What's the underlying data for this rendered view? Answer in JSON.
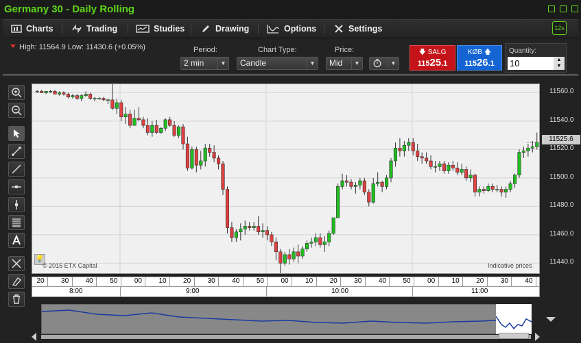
{
  "window": {
    "title": "Germany 30 - Daily Rolling"
  },
  "toolbar": {
    "charts": "Charts",
    "trading": "Trading",
    "studies": "Studies",
    "drawing": "Drawing",
    "options": "Options",
    "settings": "Settings",
    "refresh": "12s"
  },
  "header": {
    "highlow": "High: 11564.9 Low: 11430.6 (+0.05%)",
    "period_label": "Period:",
    "period_value": "2 min",
    "charttype_label": "Chart Type:",
    "charttype_value": "Candle",
    "price_label": "Price:",
    "price_value": "Mid"
  },
  "trade": {
    "sell_label": "SALG",
    "sell_small": "115",
    "sell_big": "25",
    "sell_dec": ".1",
    "buy_label": "KØB",
    "buy_small": "115",
    "buy_big": "26",
    "buy_dec": ".1",
    "quantity_label": "Quantity:",
    "quantity_value": "10"
  },
  "chart": {
    "copyright": "© 2015 ETX Capital",
    "indicative": "Indicative prices",
    "last_price": "11525.6",
    "y_ticks": [
      "11560.0",
      "11540.0",
      "11520.0",
      "11500.0",
      "11480.0",
      "11460.0",
      "11440.0"
    ],
    "minute_ticks": [
      "20",
      "30",
      "40",
      "50",
      "00",
      "10",
      "20",
      "30",
      "40",
      "50",
      "00",
      "10",
      "20",
      "30",
      "40",
      "50",
      "00",
      "10",
      "20",
      "30",
      "40"
    ],
    "hour_ticks": [
      "8:00",
      "9:00",
      "10:00",
      "11:00"
    ]
  },
  "colors": {
    "up": "#1fbf1f",
    "down": "#e04040",
    "accent": "#5fd31a"
  },
  "chart_data": {
    "type": "candlestick",
    "ylim": [
      11432,
      11566
    ],
    "candles": [
      [
        11561,
        11562,
        11560,
        11561
      ],
      [
        11561,
        11562,
        11560,
        11560
      ],
      [
        11560,
        11561,
        11559,
        11561
      ],
      [
        11561,
        11562,
        11560,
        11561
      ],
      [
        11561,
        11562,
        11559,
        11559
      ],
      [
        11559,
        11561,
        11558,
        11560
      ],
      [
        11560,
        11561,
        11558,
        11559
      ],
      [
        11559,
        11560,
        11556,
        11557
      ],
      [
        11557,
        11559,
        11556,
        11558
      ],
      [
        11558,
        11559,
        11555,
        11556
      ],
      [
        11556,
        11559,
        11554,
        11558
      ],
      [
        11558,
        11561,
        11557,
        11559
      ],
      [
        11559,
        11560,
        11555,
        11556
      ],
      [
        11556,
        11557,
        11554,
        11556
      ],
      [
        11556,
        11557,
        11555,
        11556
      ],
      [
        11556,
        11557,
        11554,
        11555
      ],
      [
        11555,
        11556,
        11552,
        11555
      ],
      [
        11555,
        11566,
        11548,
        11549
      ],
      [
        11549,
        11556,
        11545,
        11553
      ],
      [
        11553,
        11555,
        11540,
        11543
      ],
      [
        11543,
        11550,
        11538,
        11545
      ],
      [
        11545,
        11548,
        11535,
        11537
      ],
      [
        11537,
        11548,
        11537,
        11542
      ],
      [
        11542,
        11550,
        11540,
        11541
      ],
      [
        11541,
        11543,
        11535,
        11537
      ],
      [
        11537,
        11542,
        11530,
        11532
      ],
      [
        11532,
        11540,
        11529,
        11537
      ],
      [
        11537,
        11541,
        11531,
        11532
      ],
      [
        11532,
        11536,
        11531,
        11535
      ],
      [
        11535,
        11542,
        11533,
        11541
      ],
      [
        11541,
        11543,
        11536,
        11537
      ],
      [
        11537,
        11540,
        11529,
        11530
      ],
      [
        11530,
        11537,
        11528,
        11536
      ],
      [
        11536,
        11538,
        11520,
        11524
      ],
      [
        11524,
        11529,
        11505,
        11507
      ],
      [
        11507,
        11522,
        11506,
        11520
      ],
      [
        11520,
        11522,
        11504,
        11509
      ],
      [
        11509,
        11519,
        11506,
        11512
      ],
      [
        11512,
        11524,
        11508,
        11521
      ],
      [
        11521,
        11524,
        11515,
        11518
      ],
      [
        11518,
        11523,
        11511,
        11514
      ],
      [
        11514,
        11516,
        11506,
        11510
      ],
      [
        11510,
        11512,
        11488,
        11492
      ],
      [
        11492,
        11494,
        11461,
        11465
      ],
      [
        11465,
        11469,
        11455,
        11458
      ],
      [
        11458,
        11464,
        11455,
        11462
      ],
      [
        11462,
        11468,
        11456,
        11464
      ],
      [
        11464,
        11470,
        11460,
        11466
      ],
      [
        11466,
        11469,
        11463,
        11465
      ],
      [
        11465,
        11469,
        11463,
        11466
      ],
      [
        11466,
        11473,
        11460,
        11462
      ],
      [
        11462,
        11468,
        11458,
        11463
      ],
      [
        11463,
        11466,
        11456,
        11460
      ],
      [
        11460,
        11462,
        11452,
        11455
      ],
      [
        11455,
        11458,
        11442,
        11448
      ],
      [
        11448,
        11450,
        11432,
        11440
      ],
      [
        11440,
        11448,
        11438,
        11446
      ],
      [
        11446,
        11450,
        11439,
        11443
      ],
      [
        11443,
        11451,
        11441,
        11448
      ],
      [
        11448,
        11453,
        11440,
        11445
      ],
      [
        11445,
        11452,
        11443,
        11450
      ],
      [
        11450,
        11456,
        11448,
        11454
      ],
      [
        11454,
        11458,
        11451,
        11455
      ],
      [
        11455,
        11461,
        11452,
        11458
      ],
      [
        11458,
        11461,
        11451,
        11453
      ],
      [
        11453,
        11459,
        11448,
        11455
      ],
      [
        11455,
        11463,
        11452,
        11461
      ],
      [
        11461,
        11472,
        11460,
        11472
      ],
      [
        11472,
        11496,
        11472,
        11494
      ],
      [
        11494,
        11503,
        11492,
        11498
      ],
      [
        11498,
        11502,
        11494,
        11497
      ],
      [
        11497,
        11499,
        11492,
        11494
      ],
      [
        11494,
        11497,
        11489,
        11495
      ],
      [
        11495,
        11500,
        11492,
        11498
      ],
      [
        11498,
        11500,
        11488,
        11490
      ],
      [
        11490,
        11492,
        11480,
        11483
      ],
      [
        11483,
        11500,
        11482,
        11496
      ],
      [
        11496,
        11504,
        11494,
        11497
      ],
      [
        11497,
        11498,
        11490,
        11494
      ],
      [
        11494,
        11502,
        11492,
        11500
      ],
      [
        11500,
        11514,
        11497,
        11512
      ],
      [
        11512,
        11525,
        11508,
        11521
      ],
      [
        11521,
        11528,
        11515,
        11519
      ],
      [
        11519,
        11526,
        11515,
        11523
      ],
      [
        11523,
        11528,
        11519,
        11525
      ],
      [
        11525,
        11528,
        11516,
        11519
      ],
      [
        11519,
        11524,
        11512,
        11515
      ],
      [
        11515,
        11518,
        11510,
        11514
      ],
      [
        11514,
        11518,
        11510,
        11512
      ],
      [
        11512,
        11516,
        11506,
        11508
      ],
      [
        11508,
        11512,
        11504,
        11508
      ],
      [
        11508,
        11512,
        11505,
        11510
      ],
      [
        11510,
        11512,
        11503,
        11505
      ],
      [
        11505,
        11511,
        11503,
        11509
      ],
      [
        11509,
        11512,
        11505,
        11507
      ],
      [
        11507,
        11511,
        11502,
        11504
      ],
      [
        11504,
        11510,
        11502,
        11506
      ],
      [
        11506,
        11508,
        11498,
        11500
      ],
      [
        11500,
        11506,
        11497,
        11502
      ],
      [
        11502,
        11503,
        11487,
        11490
      ],
      [
        11490,
        11494,
        11487,
        11492
      ],
      [
        11492,
        11494,
        11489,
        11491
      ],
      [
        11491,
        11496,
        11490,
        11494
      ],
      [
        11494,
        11496,
        11490,
        11492
      ],
      [
        11492,
        11495,
        11490,
        11492
      ],
      [
        11492,
        11494,
        11487,
        11490
      ],
      [
        11490,
        11494,
        11486,
        11492
      ],
      [
        11492,
        11498,
        11490,
        11496
      ],
      [
        11496,
        11503,
        11493,
        11502
      ],
      [
        11502,
        11520,
        11500,
        11518
      ],
      [
        11518,
        11522,
        11514,
        11519
      ],
      [
        11519,
        11524,
        11515,
        11521
      ],
      [
        11521,
        11526,
        11518,
        11522
      ],
      [
        11522,
        11532,
        11520,
        11525
      ]
    ]
  }
}
